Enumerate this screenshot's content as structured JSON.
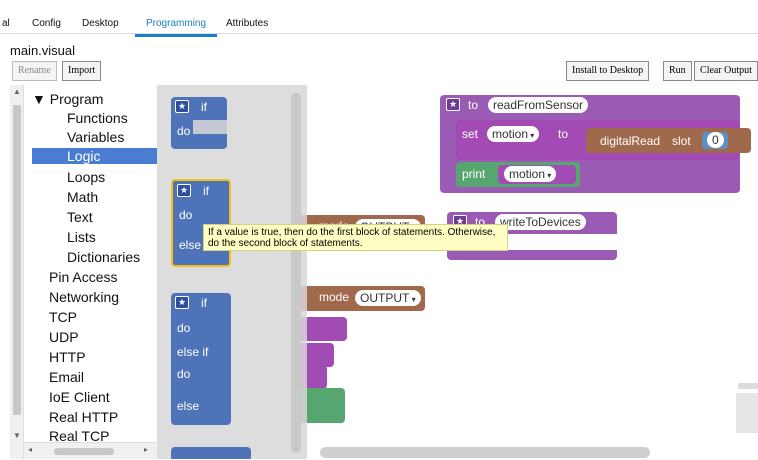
{
  "tabs": [
    {
      "label": "al"
    },
    {
      "label": "Config"
    },
    {
      "label": "Desktop"
    },
    {
      "label": "Programming"
    },
    {
      "label": "Attributes"
    }
  ],
  "file": {
    "name": "main.visual"
  },
  "buttons": {
    "rename": "Rename",
    "import": "Import",
    "install": "Install to Desktop",
    "run": "Run",
    "clear_output": "Clear Output"
  },
  "categories": [
    {
      "label": "▼ Program"
    },
    {
      "label": "Functions"
    },
    {
      "label": "Variables"
    },
    {
      "label": "Logic"
    },
    {
      "label": "Loops"
    },
    {
      "label": "Math"
    },
    {
      "label": "Text"
    },
    {
      "label": "Lists"
    },
    {
      "label": "Dictionaries"
    },
    {
      "label": "Pin Access"
    },
    {
      "label": "Networking"
    },
    {
      "label": "TCP"
    },
    {
      "label": "UDP"
    },
    {
      "label": "HTTP"
    },
    {
      "label": "Email"
    },
    {
      "label": "IoE Client"
    },
    {
      "label": "Real HTTP"
    },
    {
      "label": "Real TCP"
    }
  ],
  "blocks": {
    "read_fn_kw": "to",
    "read_fn_name": "readFromSensor",
    "set_kw": "set",
    "set_var": "motion",
    "set_to": "to",
    "digital_read": "digitalRead",
    "slot_kw": "slot",
    "slot_val": "0",
    "print_kw": "print",
    "print_var": "motion",
    "write_fn_kw": "to",
    "write_fn_name": "writeToDevices",
    "mode_kw_1": "mode",
    "mode_val_1": "OUTPUT",
    "mode_kw_2": "mode",
    "mode_val_2": "OUTPUT"
  },
  "flyout": {
    "if_kw": "if",
    "do_kw": "do",
    "else_kw": "else",
    "elseif_kw": "else if",
    "do2_kw": "do",
    "else2_kw": "else"
  },
  "tooltip": {
    "text": "If a value is true, then do the first block of statements. Otherwise, do the second block of statements."
  },
  "colors": {
    "function_purple": "#9a5bb5",
    "logic_blue": "#4f73b8",
    "pin_brown": "#a0694b",
    "variable_violet": "#a24bb5",
    "selection_yellow": "#f2c21a"
  }
}
